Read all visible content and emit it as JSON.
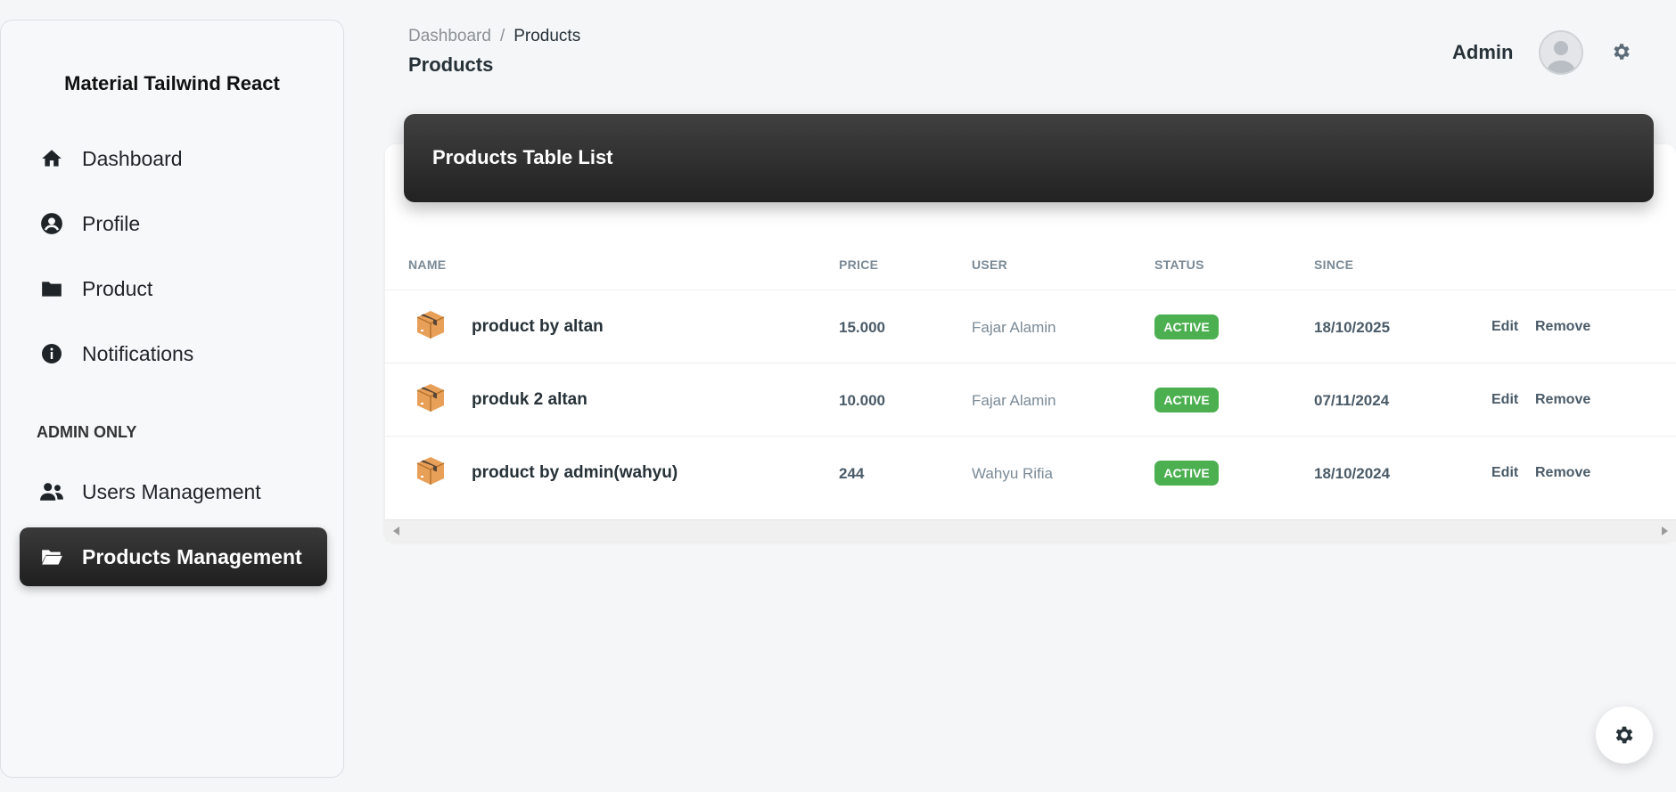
{
  "app": {
    "brand": "Material Tailwind React"
  },
  "sidebar": {
    "items": [
      {
        "label": "Dashboard",
        "icon": "home-icon"
      },
      {
        "label": "Profile",
        "icon": "user-circle-icon"
      },
      {
        "label": "Product",
        "icon": "folder-icon"
      },
      {
        "label": "Notifications",
        "icon": "info-icon"
      }
    ],
    "section_label": "ADMIN ONLY",
    "admin_items": [
      {
        "label": "Users Management",
        "icon": "users-icon"
      },
      {
        "label": "Products Management",
        "icon": "folder-open-icon",
        "active": true
      }
    ]
  },
  "header": {
    "breadcrumb": [
      "Dashboard",
      "Products"
    ],
    "breadcrumb_separator": "/",
    "title": "Products",
    "user_label": "Admin"
  },
  "table": {
    "title": "Products Table List",
    "columns": [
      "NAME",
      "PRICE",
      "USER",
      "STATUS",
      "SINCE"
    ],
    "rows": [
      {
        "name": "product by altan",
        "price": "15.000",
        "user": "Fajar Alamin",
        "status": "ACTIVE",
        "since": "18/10/2025",
        "edit": "Edit",
        "remove": "Remove"
      },
      {
        "name": "produk 2 altan",
        "price": "10.000",
        "user": "Fajar Alamin",
        "status": "ACTIVE",
        "since": "07/11/2024",
        "edit": "Edit",
        "remove": "Remove"
      },
      {
        "name": "product by admin(wahyu)",
        "price": "244",
        "user": "Wahyu Rifia",
        "status": "ACTIVE",
        "since": "18/10/2024",
        "edit": "Edit",
        "remove": "Remove"
      }
    ]
  },
  "colors": {
    "status_active": "#4caf50",
    "header_dark": "#2b2b2b"
  }
}
